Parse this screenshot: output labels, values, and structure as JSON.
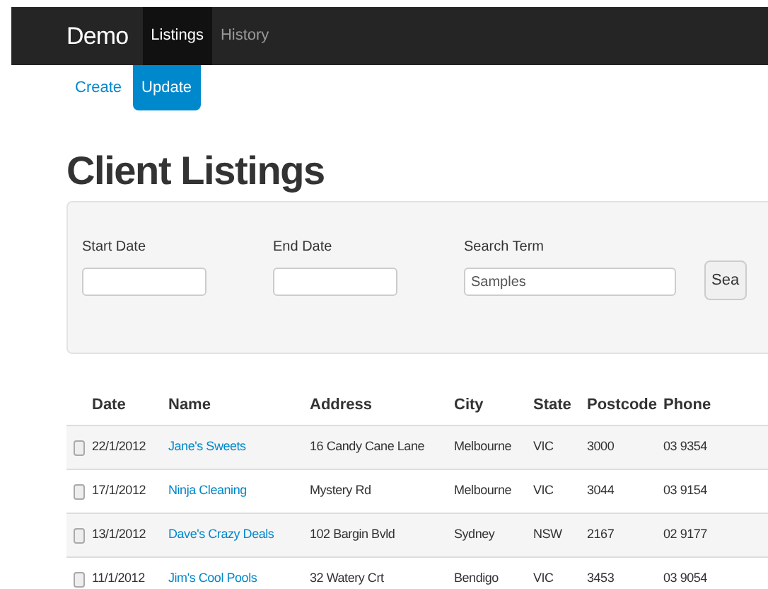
{
  "navbar": {
    "brand": "Demo",
    "items": [
      {
        "label": "Listings",
        "selected": true
      },
      {
        "label": "History",
        "selected": false
      }
    ]
  },
  "pills": [
    {
      "label": "Create",
      "selected": false
    },
    {
      "label": "Update",
      "selected": true
    }
  ],
  "title": "Client Listings",
  "filters": {
    "fields": [
      {
        "label": "Start Date"
      },
      {
        "label": "End Date"
      },
      {
        "label": "Search Term",
        "value": "Samples"
      }
    ],
    "button": "Sea"
  },
  "table": {
    "columns": [
      "Date",
      "Name",
      "Address",
      "City",
      "State",
      "Postcode",
      "Phone"
    ],
    "rows": [
      {
        "checked": false,
        "cells": [
          "22/1/2012",
          "Jane's Sweets",
          "16 Candy Cane Lane",
          "Melbourne",
          "VIC",
          "3000",
          "03 9354"
        ]
      },
      {
        "checked": false,
        "cells": [
          "17/1/2012",
          "Ninja Cleaning",
          "Mystery Rd",
          "Melbourne",
          "VIC",
          "3044",
          "03 9154"
        ]
      },
      {
        "checked": false,
        "cells": [
          "13/1/2012",
          "Dave's Crazy Deals",
          "102 Bargin Bvld",
          "Sydney",
          "NSW",
          "2167",
          "02 9177"
        ]
      },
      {
        "checked": false,
        "cells": [
          "11/1/2012",
          "Jim's Cool Pools",
          "32 Watery Crt",
          "Bendigo",
          "VIC",
          "3453",
          "03 9054"
        ]
      }
    ]
  }
}
